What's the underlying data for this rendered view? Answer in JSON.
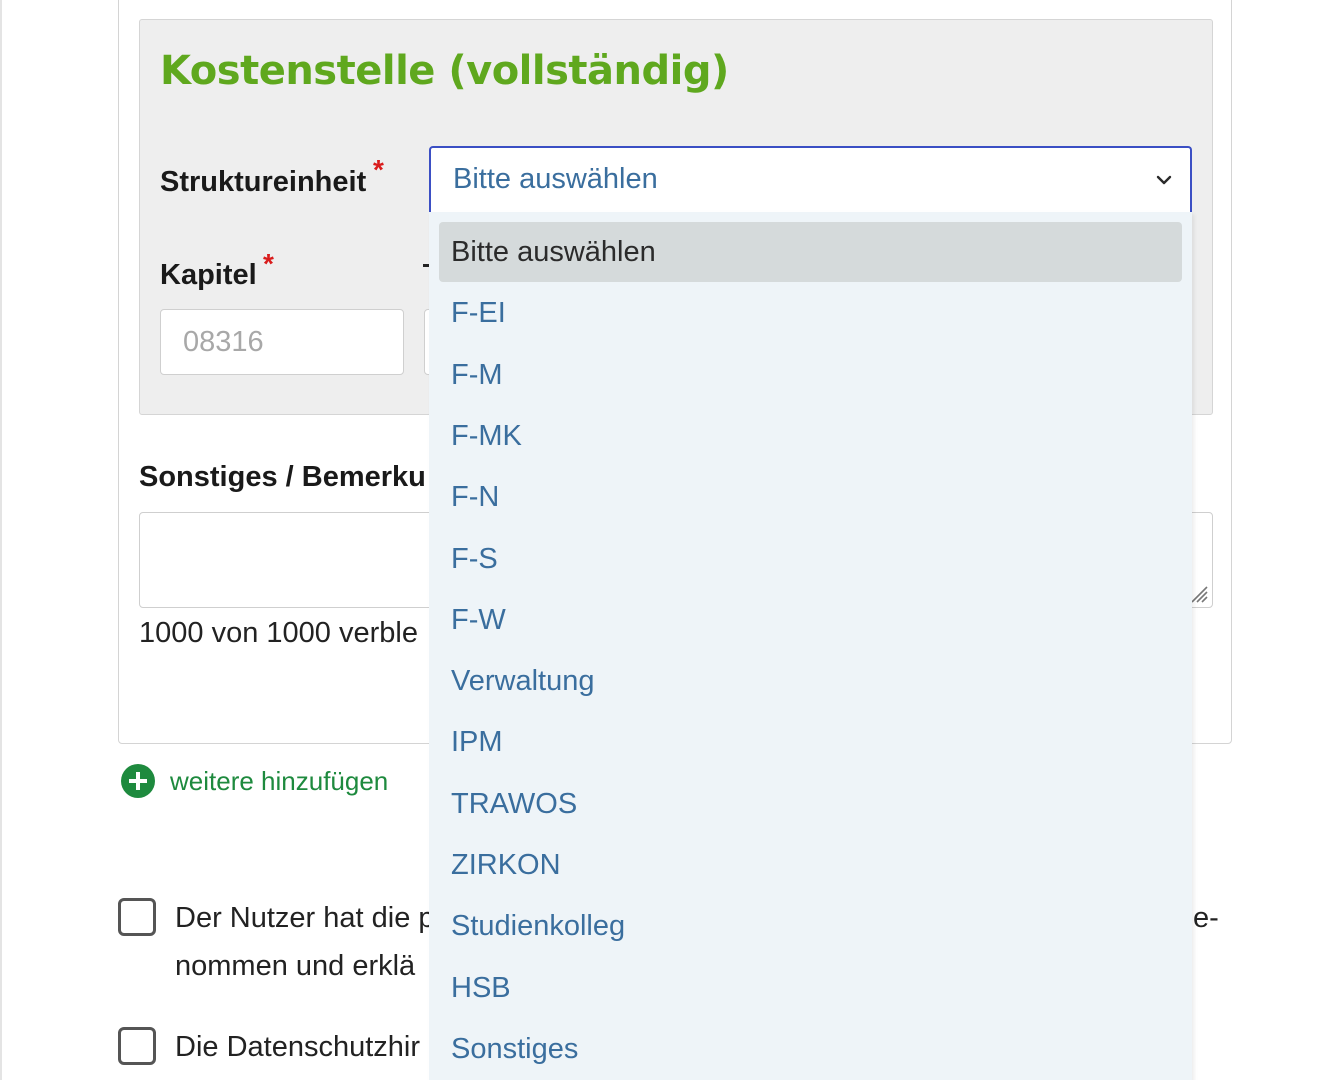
{
  "panel": {
    "title": "Kostenstelle (vollständig)",
    "struktureinheit_label": "Struktureinheit",
    "required_mark": "*",
    "select_value": "Bitte auswählen",
    "kapitel_label": "Kapitel",
    "kapitel_placeholder": "08316"
  },
  "dropdown": {
    "options": [
      "Bitte auswählen",
      "F-EI",
      "F-M",
      "F-MK",
      "F-N",
      "F-S",
      "F-W",
      "Verwaltung",
      "IPM",
      "TRAWOS",
      "ZIRKON",
      "Studienkolleg",
      "HSB",
      "Sonstiges"
    ],
    "selected": "Bitte auswählen"
  },
  "remarks": {
    "label": "Sonstiges / Bemerku",
    "counter": "1000 von 1000 verble"
  },
  "add_more": {
    "label": "weitere hinzufügen"
  },
  "checkboxes": {
    "first_line1": "Der Nutzer hat die p",
    "first_line2": "nommen und erklä",
    "first_tail": "e-",
    "second": "Die Datenschutzhir"
  },
  "colors": {
    "title_green": "#5fa81e",
    "accent_green": "#1e8a3e",
    "focus_blue": "#3b4fc4",
    "option_blue": "#3a6e9e",
    "required_red": "#d91c1c"
  }
}
